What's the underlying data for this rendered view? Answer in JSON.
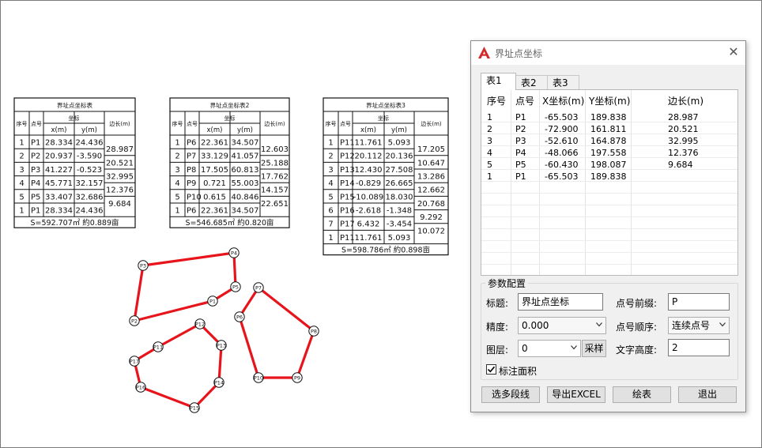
{
  "drawing": {
    "tables": [
      {
        "title": "界址点坐标表",
        "col_seq": "序号",
        "col_pt": "点号",
        "col_coord": "坐标",
        "col_x": "x(m)",
        "col_y": "y(m)",
        "col_len": "边长(m)",
        "rows": [
          {
            "seq": "1",
            "pt": "P1",
            "x": "28.334",
            "y": "24.436"
          },
          {
            "seq": "2",
            "pt": "P2",
            "x": "20.937",
            "y": "-3.590"
          },
          {
            "seq": "3",
            "pt": "P3",
            "x": "41.227",
            "y": "-0.523"
          },
          {
            "seq": "4",
            "pt": "P4",
            "x": "45.771",
            "y": "32.157"
          },
          {
            "seq": "5",
            "pt": "P5",
            "x": "33.407",
            "y": "32.686"
          },
          {
            "seq": "1",
            "pt": "P1",
            "x": "28.334",
            "y": "24.436"
          }
        ],
        "edges": [
          "28.987",
          "20.521",
          "32.995",
          "12.376",
          "9.684"
        ],
        "area": "S=592.707㎡ 約0.889亩"
      },
      {
        "title": "界址点坐标表2",
        "col_seq": "序号",
        "col_pt": "点号",
        "col_coord": "坐标",
        "col_x": "x(m)",
        "col_y": "y(m)",
        "col_len": "边长(m)",
        "rows": [
          {
            "seq": "1",
            "pt": "P6",
            "x": "22.361",
            "y": "34.507"
          },
          {
            "seq": "2",
            "pt": "P7",
            "x": "33.129",
            "y": "41.057"
          },
          {
            "seq": "3",
            "pt": "P8",
            "x": "17.505",
            "y": "60.813"
          },
          {
            "seq": "4",
            "pt": "P9",
            "x": "0.721",
            "y": "55.003"
          },
          {
            "seq": "5",
            "pt": "P10",
            "x": "0.615",
            "y": "40.846"
          },
          {
            "seq": "1",
            "pt": "P6",
            "x": "22.361",
            "y": "34.507"
          }
        ],
        "edges": [
          "12.603",
          "25.188",
          "17.762",
          "14.157",
          "22.651"
        ],
        "area": "S=546.685㎡ 約0.820亩"
      },
      {
        "title": "界址点坐标表3",
        "col_seq": "序号",
        "col_pt": "点号",
        "col_coord": "坐标",
        "col_x": "x(m)",
        "col_y": "y(m)",
        "col_len": "边长(m)",
        "rows": [
          {
            "seq": "1",
            "pt": "P11",
            "x": "11.761",
            "y": "5.093"
          },
          {
            "seq": "2",
            "pt": "P12",
            "x": "20.112",
            "y": "20.136"
          },
          {
            "seq": "3",
            "pt": "P13",
            "x": "12.430",
            "y": "27.508"
          },
          {
            "seq": "4",
            "pt": "P14",
            "x": "-0.829",
            "y": "26.665"
          },
          {
            "seq": "5",
            "pt": "P15",
            "x": "-10.089",
            "y": "18.030"
          },
          {
            "seq": "6",
            "pt": "P16",
            "x": "-2.618",
            "y": "-1.348"
          },
          {
            "seq": "7",
            "pt": "P17",
            "x": "6.432",
            "y": "-3.454"
          },
          {
            "seq": "1",
            "pt": "P11",
            "x": "11.761",
            "y": "5.093"
          }
        ],
        "edges": [
          "17.205",
          "10.647",
          "13.286",
          "12.662",
          "20.768",
          "9.292",
          "10.072"
        ],
        "area": "S=598.786㎡ 約0.898亩"
      }
    ],
    "point_labels": {
      "P1": "P1",
      "P2": "P2",
      "P3": "P3",
      "P4": "P4",
      "P5": "P5",
      "P6": "P6",
      "P7": "P7",
      "P8": "P8",
      "P9": "P9",
      "P10": "P10",
      "P11": "P11",
      "P12": "P12",
      "P13": "P13",
      "P14": "P14",
      "P15": "P15",
      "P16": "P16",
      "P17": "P17"
    },
    "line_color": "#e8141c"
  },
  "dialog": {
    "title": "界址点坐标",
    "close": "✕",
    "tabs": [
      "表1",
      "表2",
      "表3"
    ],
    "columns": [
      "序号",
      "点号",
      "X坐标(m)",
      "Y坐标(m)",
      "边长(m)"
    ],
    "rows": [
      [
        "1",
        "P1",
        "-65.503",
        "189.838",
        "28.987"
      ],
      [
        "2",
        "P2",
        "-72.900",
        "161.811",
        "20.521"
      ],
      [
        "3",
        "P3",
        "-52.610",
        "164.878",
        "32.995"
      ],
      [
        "4",
        "P4",
        "-48.066",
        "197.558",
        "12.376"
      ],
      [
        "5",
        "P5",
        "-60.430",
        "198.087",
        "9.684"
      ],
      [
        "1",
        "P1",
        "-65.503",
        "189.838",
        ""
      ]
    ],
    "config": {
      "group_title": "参数配置",
      "title_label": "标题:",
      "title_value": "界址点坐标",
      "prefix_label": "点号前缀:",
      "prefix_value": "P",
      "precision_label": "精度:",
      "precision_value": "0.000",
      "order_label": "点号顺序:",
      "order_value": "连续点号",
      "layer_label": "图层:",
      "layer_value": "0",
      "sample_button": "采样",
      "text_height_label": "文字高度:",
      "text_height_value": "2",
      "annotate_area_label": "标注面积",
      "annotate_area_checked": true
    },
    "buttons": {
      "select": "选多段线",
      "export": "导出EXCEL",
      "draw": "绘表",
      "exit": "退出"
    }
  }
}
